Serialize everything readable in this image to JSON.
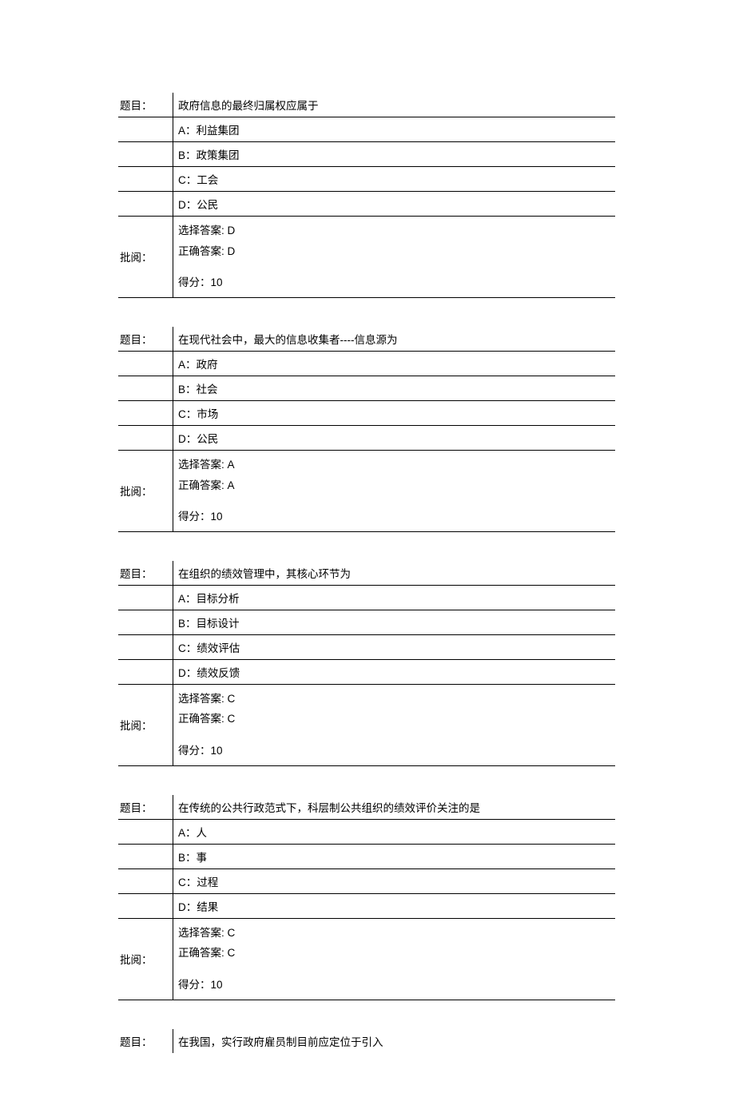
{
  "labels": {
    "question": "题目：",
    "review": "批阅：",
    "chosen": "选择答案:",
    "correct": "正确答案:",
    "score": "得分："
  },
  "questions": [
    {
      "text": "政府信息的最终归属权应属于",
      "options": [
        {
          "letter": "A：",
          "text": "利益集团"
        },
        {
          "letter": "B：",
          "text": "政策集团"
        },
        {
          "letter": "C：",
          "text": "工会"
        },
        {
          "letter": "D：",
          "text": "公民"
        }
      ],
      "chosen": "D",
      "correct": "D",
      "score": "10"
    },
    {
      "text": "在现代社会中，最大的信息收集者----信息源为",
      "options": [
        {
          "letter": "A：",
          "text": "政府"
        },
        {
          "letter": "B：",
          "text": "社会"
        },
        {
          "letter": "C：",
          "text": "市场"
        },
        {
          "letter": "D：",
          "text": "公民"
        }
      ],
      "chosen": "A",
      "correct": "A",
      "score": "10"
    },
    {
      "text": "在组织的绩效管理中，其核心环节为",
      "options": [
        {
          "letter": "A：",
          "text": "目标分析"
        },
        {
          "letter": "B：",
          "text": "目标设计"
        },
        {
          "letter": "C：",
          "text": "绩效评估"
        },
        {
          "letter": "D：",
          "text": "绩效反馈"
        }
      ],
      "chosen": "C",
      "correct": "C",
      "score": "10"
    },
    {
      "text": "在传统的公共行政范式下，科层制公共组织的绩效评价关注的是",
      "options": [
        {
          "letter": "A：",
          "text": "人"
        },
        {
          "letter": "B：",
          "text": "事"
        },
        {
          "letter": "C：",
          "text": "过程"
        },
        {
          "letter": "D：",
          "text": "结果"
        }
      ],
      "chosen": "C",
      "correct": "C",
      "score": "10"
    },
    {
      "text": "在我国，实行政府雇员制目前应定位于引入",
      "options": [],
      "chosen": null,
      "correct": null,
      "score": null
    }
  ]
}
